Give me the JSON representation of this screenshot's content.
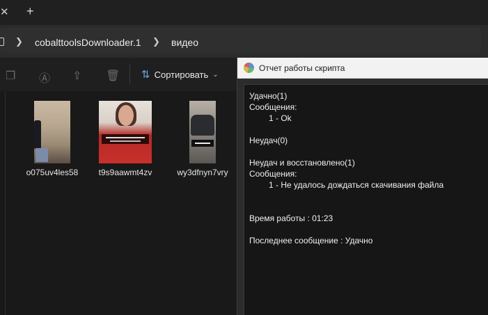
{
  "explorer": {
    "tabbar": {
      "close_glyph": "✕",
      "new_tab_glyph": "+"
    },
    "breadcrumb": [
      "cobalttoolsDownloader.1",
      "видео"
    ],
    "toolbar": {
      "sort_label": "Сортировать"
    },
    "files": [
      {
        "name": "o075uv4les58"
      },
      {
        "name": "t9s9aawmt4zv"
      },
      {
        "name": "wy3dfnyn7vry"
      }
    ]
  },
  "report": {
    "title": "Отчет работы скрипта",
    "lines": {
      "success_header": "Удачно(1)",
      "success_messages_label": "Сообщения:",
      "success_message_1": "1 - Ok",
      "fail_header": "Неудач(0)",
      "restored_header": "Неудач и восстановлено(1)",
      "restored_messages_label": "Сообщения:",
      "restored_message_1": "1 - Не удалось дождаться скачивания файла",
      "runtime": "Время работы : 01:23",
      "last_message": "Последнее сообщение : Удачно"
    }
  }
}
